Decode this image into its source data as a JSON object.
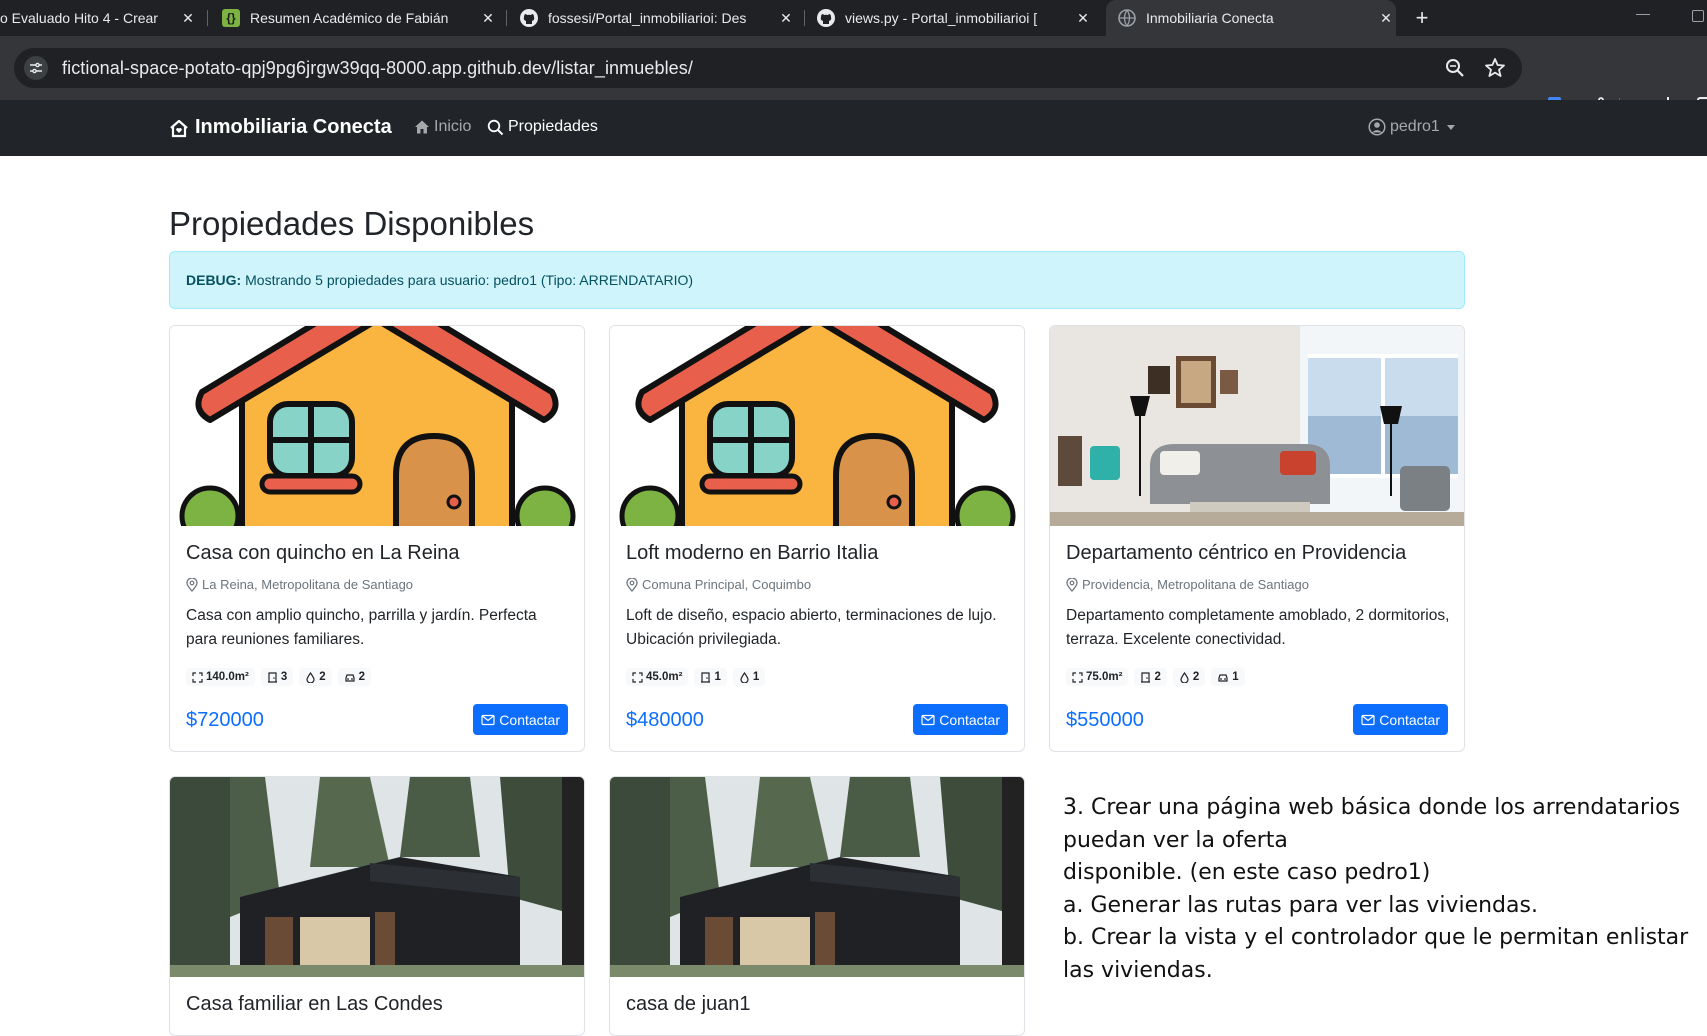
{
  "browser": {
    "tabs": [
      {
        "title": "o Evaluado Hito 4 - Crear",
        "active": false
      },
      {
        "title": "Resumen Académico de Fabián",
        "active": false
      },
      {
        "title": "fossesi/Portal_inmobiliarioi: Des",
        "active": false
      },
      {
        "title": "views.py - Portal_inmobiliarioi [",
        "active": false
      },
      {
        "title": "Inmobiliaria Conecta",
        "active": true
      }
    ],
    "url": "fictional-space-potato-qpj9pg6jrgw39qq-8000.app.github.dev/listar_inmuebles/"
  },
  "navbar": {
    "brand": "Inmobiliaria Conecta",
    "links": [
      {
        "label": "Inicio",
        "active": false
      },
      {
        "label": "Propiedades",
        "active": true
      }
    ],
    "user": "pedro1"
  },
  "page": {
    "title": "Propiedades Disponibles",
    "debug": {
      "label": "DEBUG:",
      "message": "Mostrando 5 propiedades para usuario: pedro1 (Tipo: ARRENDATARIO)"
    }
  },
  "properties": [
    {
      "image": "house-illustration",
      "title": "Casa con quincho en La Reina",
      "location": "La Reina, Metropolitana de Santiago",
      "description": "Casa con amplio quincho, parrilla y jardín. Perfecta para reuniones familiares.",
      "area": "140.0m²",
      "rooms": "3",
      "baths": "2",
      "parking": "2",
      "price": "$720000",
      "button": "Contactar"
    },
    {
      "image": "house-illustration",
      "title": "Loft moderno en Barrio Italia",
      "location": "Comuna Principal, Coquimbo",
      "description": "Loft de diseño, espacio abierto, terminaciones de lujo. Ubicación privilegiada.",
      "area": "45.0m²",
      "rooms": "1",
      "baths": "1",
      "price": "$480000",
      "button": "Contactar"
    },
    {
      "image": "living-room-photo",
      "title": "Departamento céntrico en Providencia",
      "location": "Providencia, Metropolitana de Santiago",
      "description": "Departamento completamente amoblado, 2 dormitorios, terraza. Excelente conectividad.",
      "area": "75.0m²",
      "rooms": "2",
      "baths": "2",
      "parking": "1",
      "price": "$550000",
      "button": "Contactar"
    },
    {
      "image": "modern-cabin-photo",
      "title": "Casa familiar en Las Condes"
    },
    {
      "image": "modern-cabin-photo",
      "title": "casa de juan1"
    }
  ],
  "note": {
    "lines": [
      "3. Crear una página web básica donde los arrendatarios",
      "puedan ver la oferta",
      "disponible. (en este caso pedro1)",
      "a. Generar las rutas para ver las viviendas.",
      "b. Crear la vista y el controlador que le permitan enlistar",
      "las viviendas."
    ]
  },
  "colors": {
    "primary": "#0d6efd",
    "navbar": "#212529",
    "debug_bg": "#cff4fc",
    "debug_text": "#055160"
  }
}
